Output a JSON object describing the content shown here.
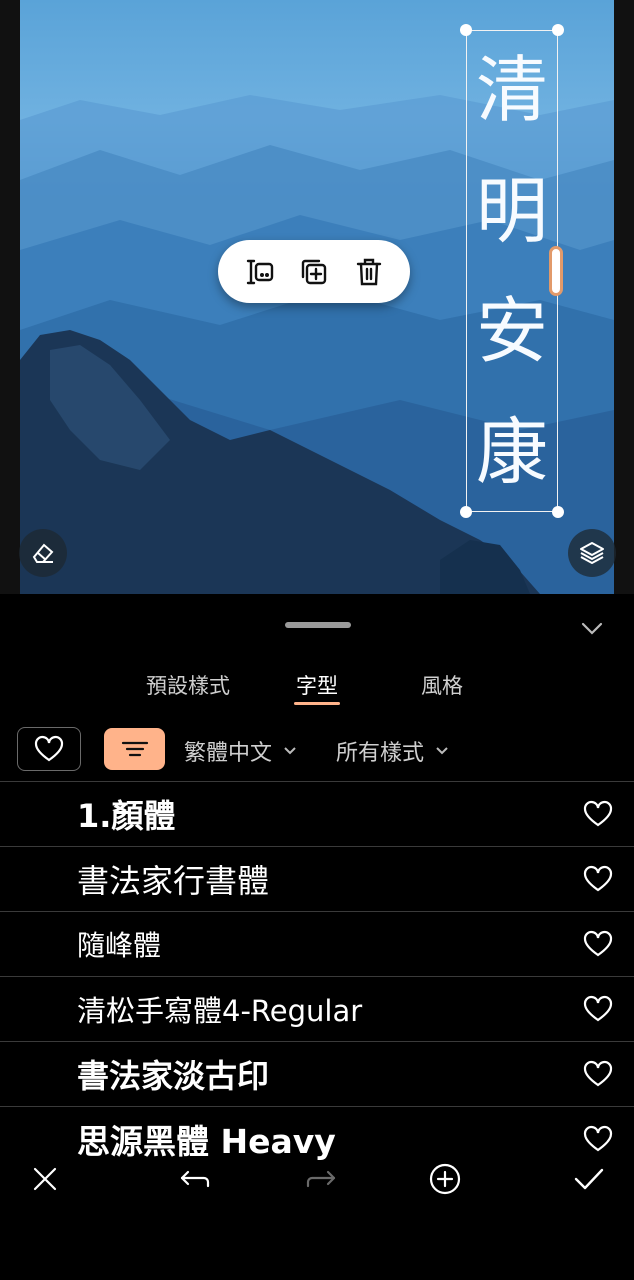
{
  "editor": {
    "vertical_text": [
      "清",
      "明",
      "安",
      "康"
    ],
    "popup_icons": [
      "text-edit-icon",
      "duplicate-icon",
      "trash-icon"
    ],
    "left_fab_icon": "eraser-icon",
    "right_fab_icon": "layers-icon"
  },
  "sheet": {
    "tabs": [
      {
        "label": "預設樣式"
      },
      {
        "label": "字型"
      },
      {
        "label": "風格"
      }
    ],
    "active_tab": "字型",
    "filters": {
      "favorite_icon": "heart-icon",
      "filter_icon": "filter-lines-icon",
      "language": "繁體中文",
      "style": "所有樣式"
    },
    "fonts": [
      {
        "name": "1.顏體"
      },
      {
        "name": "書法家行書體"
      },
      {
        "name": "隨峰體"
      },
      {
        "name": "清松手寫體4-Regular"
      },
      {
        "name": "書法家淡古印"
      },
      {
        "name": "思源黑體 Heavy"
      }
    ]
  },
  "toolbar": {
    "icons": [
      "close-icon",
      "undo-icon",
      "redo-icon",
      "add-circle-icon",
      "check-icon"
    ]
  },
  "colors": {
    "accent": "#ffb38a",
    "handle_accent": "#e29a6a"
  }
}
